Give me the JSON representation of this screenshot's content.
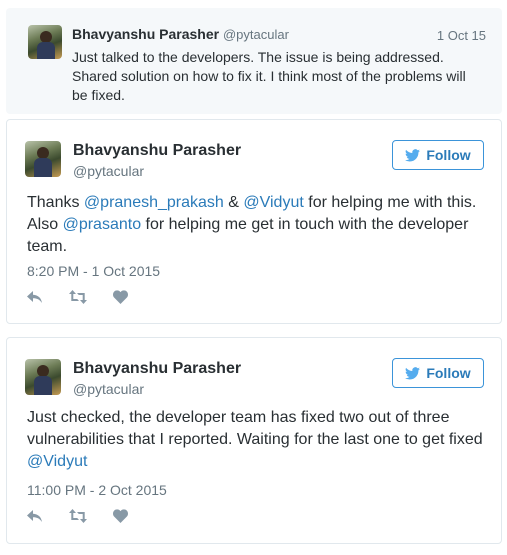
{
  "reply": {
    "name": "Bhavyanshu Parasher",
    "handle": "@pytacular",
    "date": "1 Oct 15",
    "text": "Just talked to the developers. The issue is being addressed. Shared solution on how to fix it. I think most of the problems will be fixed."
  },
  "tweet1": {
    "name": "Bhavyanshu Parasher",
    "handle": "@pytacular",
    "follow_label": "Follow",
    "text_parts": {
      "p1": "Thanks ",
      "m1": "@pranesh_prakash",
      "p2": " & ",
      "m2": "@Vidyut",
      "p3": " for helping me with this. Also ",
      "m3": "@prasanto",
      "p4": " for helping me get in touch with the developer team."
    },
    "timestamp": "8:20 PM - 1 Oct 2015"
  },
  "tweet2": {
    "name": "Bhavyanshu Parasher",
    "handle": "@pytacular",
    "follow_label": "Follow",
    "text_parts": {
      "p1": "Just checked, the developer team has fixed two out of three vulnerabilities that I reported. Waiting for the last one to get fixed ",
      "m1": "@Vidyut"
    },
    "timestamp": "11:00 PM - 2 Oct 2015"
  },
  "icons": {
    "reply": "reply-icon",
    "retweet": "retweet-icon",
    "like": "heart-icon",
    "bird": "twitter-bird-icon"
  },
  "colors": {
    "link": "#2b7bb9",
    "muted": "#66757f",
    "reply_bg": "#f5f8fa",
    "border": "#e1e8ed"
  }
}
